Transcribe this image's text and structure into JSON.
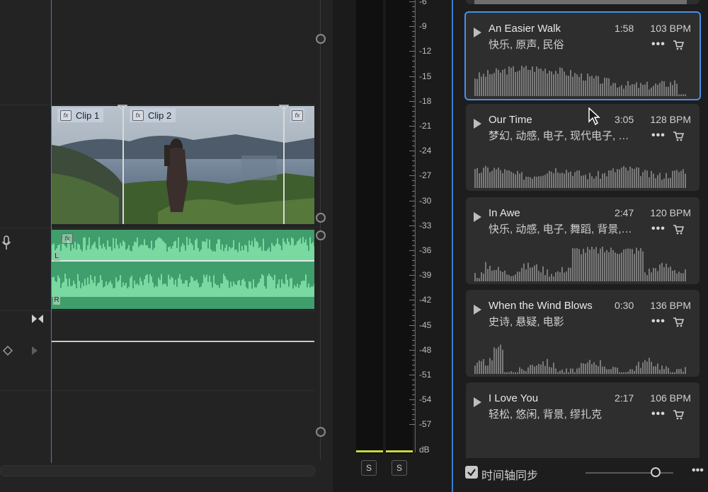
{
  "timeline": {
    "clips": [
      {
        "label": "Clip 1",
        "fx": "fx"
      },
      {
        "label": "Clip 2",
        "fx": "fx"
      },
      {
        "label": "",
        "fx": "fx"
      }
    ],
    "audio_fx": "fx",
    "channel_left": "L",
    "channel_right": "R"
  },
  "meter": {
    "scale": [
      "-6",
      "-9",
      "-12",
      "-15",
      "-18",
      "-21",
      "-24",
      "-27",
      "-30",
      "-33",
      "-36",
      "-39",
      "-42",
      "-45",
      "-48",
      "-51",
      "-54",
      "-57",
      "dB"
    ],
    "solo_1": "S",
    "solo_2": "S",
    "level_color": "#c9d840"
  },
  "music": {
    "tracks": [
      {
        "title": "An Easier Walk",
        "tags": "快乐, 原声, 民俗",
        "duration": "1:58",
        "bpm": "103 BPM",
        "selected": true
      },
      {
        "title": "Our Time",
        "tags": "梦幻, 动感, 电子, 现代电子, …",
        "duration": "3:05",
        "bpm": "128 BPM",
        "selected": false
      },
      {
        "title": "In Awe",
        "tags": "快乐, 动感, 电子, 舞蹈, 背景,…",
        "duration": "2:47",
        "bpm": "120 BPM",
        "selected": false
      },
      {
        "title": "When the Wind Blows",
        "tags": "史诗, 悬疑, 电影",
        "duration": "0:30",
        "bpm": "136 BPM",
        "selected": false
      },
      {
        "title": "I Love You",
        "tags": "轻松, 悠闲, 背景, 缪扎克",
        "duration": "2:17",
        "bpm": "106 BPM",
        "selected": false
      }
    ],
    "more_label": "•••",
    "sync_label": "时间轴同步",
    "sync_checked": true,
    "accent_color": "#3b7ed6"
  }
}
